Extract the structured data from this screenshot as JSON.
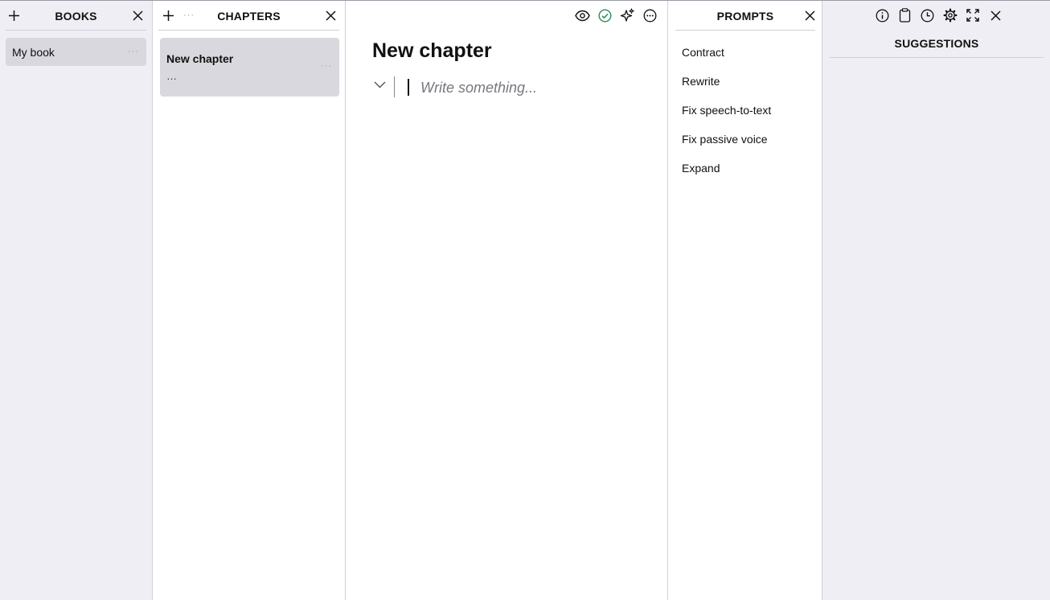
{
  "books": {
    "title": "BOOKS",
    "items": [
      {
        "label": "My book",
        "menu": "···"
      }
    ]
  },
  "chapters": {
    "title": "CHAPTERS",
    "toolbar_more": "···",
    "items": [
      {
        "title": "New chapter",
        "excerpt": "…",
        "menu": "···"
      }
    ]
  },
  "editor": {
    "title": "New chapter",
    "placeholder": "Write something...",
    "toolbar_icons": [
      "eye-icon",
      "check-circle-icon",
      "sparkles-icon",
      "more-icon"
    ],
    "accent_check": "#2e8b57"
  },
  "prompts": {
    "title": "PROMPTS",
    "items": [
      "Contract",
      "Rewrite",
      "Fix speech-to-text",
      "Fix passive voice",
      "Expand"
    ]
  },
  "suggestions": {
    "title": "SUGGESTIONS",
    "toolbar_icons": [
      "info-icon",
      "clipboard-icon",
      "clock-icon",
      "gear-icon",
      "expand-icon",
      "close-icon"
    ]
  },
  "colors": {
    "sidebar_bg": "#efeef4",
    "item_bg": "#d9d8de",
    "panel_bg": "#ffffff"
  }
}
